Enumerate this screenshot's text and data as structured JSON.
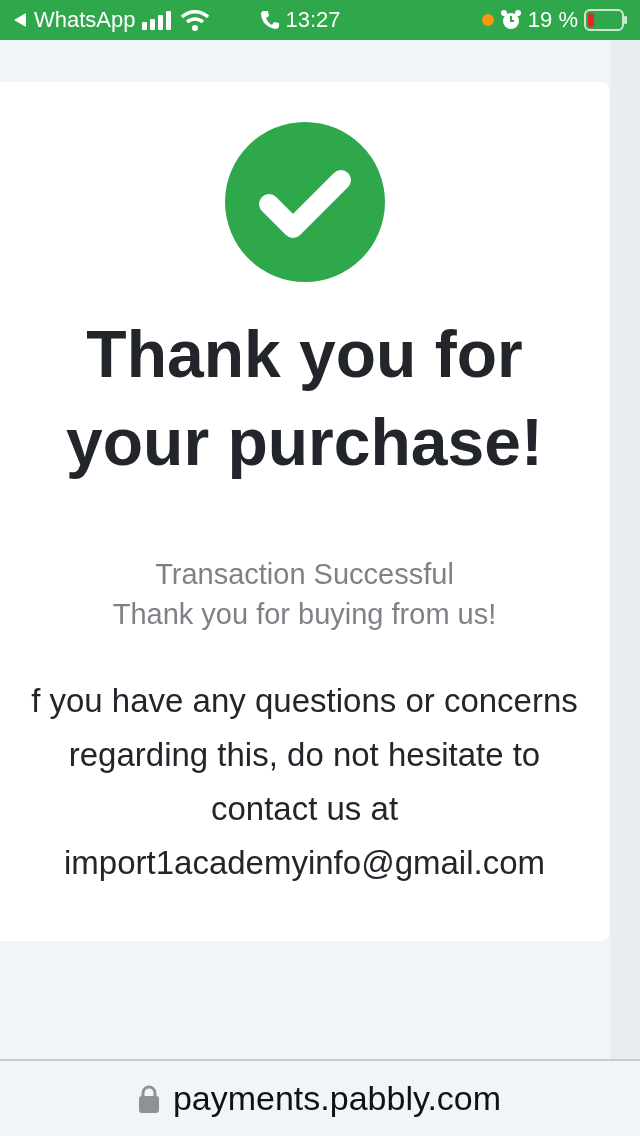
{
  "status_bar": {
    "back_app": "WhatsApp",
    "time": "13:27",
    "battery": "19 %"
  },
  "confirmation": {
    "title": "Thank you for your purchase!",
    "status": "Transaction Successful",
    "subtitle": "Thank you for buying from us!",
    "message": "f you have any questions or concerns regarding this, do not hesitate to contact us at import1academyinfo@gmail.com"
  },
  "address_bar": {
    "url": "payments.pabbly.com"
  }
}
